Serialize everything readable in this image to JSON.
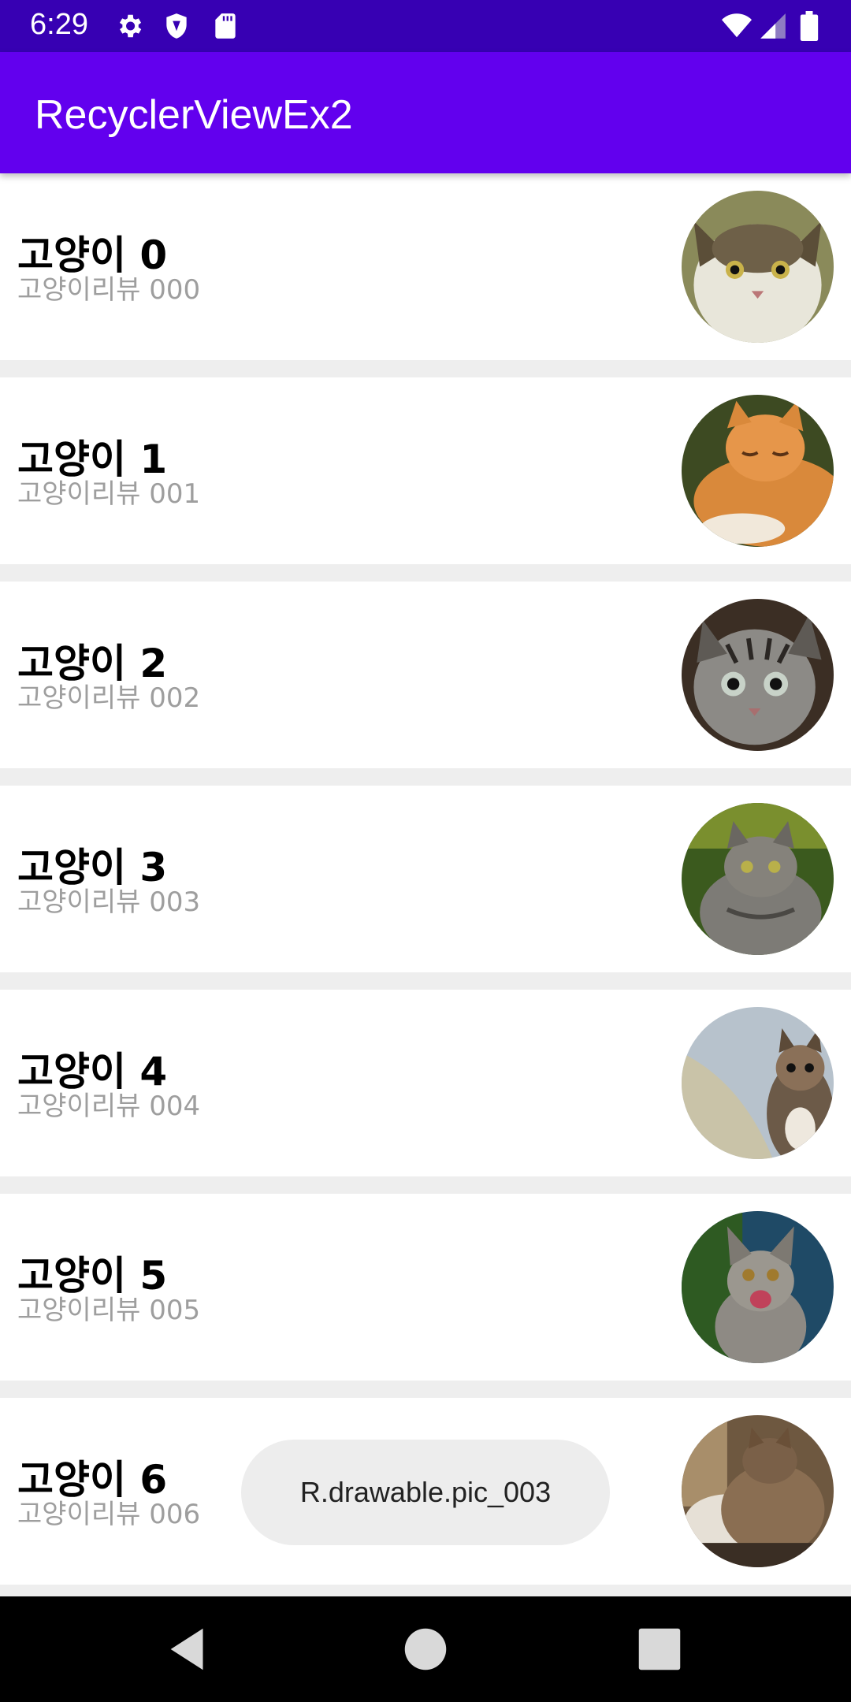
{
  "status_bar": {
    "time": "6:29",
    "icons": [
      "gear-icon",
      "shield-icon",
      "sd-card-icon",
      "wifi-icon",
      "cell-signal-icon",
      "battery-icon"
    ],
    "background": "#3700b3"
  },
  "app_bar": {
    "title": "RecyclerViewEx2",
    "background": "#6200ee"
  },
  "items": [
    {
      "title": "고양이 0",
      "subtitle": "고양이리뷰 000",
      "image": "cat-photo-0"
    },
    {
      "title": "고양이 1",
      "subtitle": "고양이리뷰 001",
      "image": "cat-photo-1"
    },
    {
      "title": "고양이 2",
      "subtitle": "고양이리뷰 002",
      "image": "cat-photo-2"
    },
    {
      "title": "고양이 3",
      "subtitle": "고양이리뷰 003",
      "image": "cat-photo-3"
    },
    {
      "title": "고양이 4",
      "subtitle": "고양이리뷰 004",
      "image": "cat-photo-4"
    },
    {
      "title": "고양이 5",
      "subtitle": "고양이리뷰 005",
      "image": "cat-photo-5"
    },
    {
      "title": "고양이 6",
      "subtitle": "고양이리뷰 006",
      "image": "cat-photo-6"
    }
  ],
  "toast": {
    "text": "R.drawable.pic_003"
  },
  "nav_bar": {
    "buttons": [
      "back-icon",
      "home-icon",
      "recents-icon"
    ]
  }
}
